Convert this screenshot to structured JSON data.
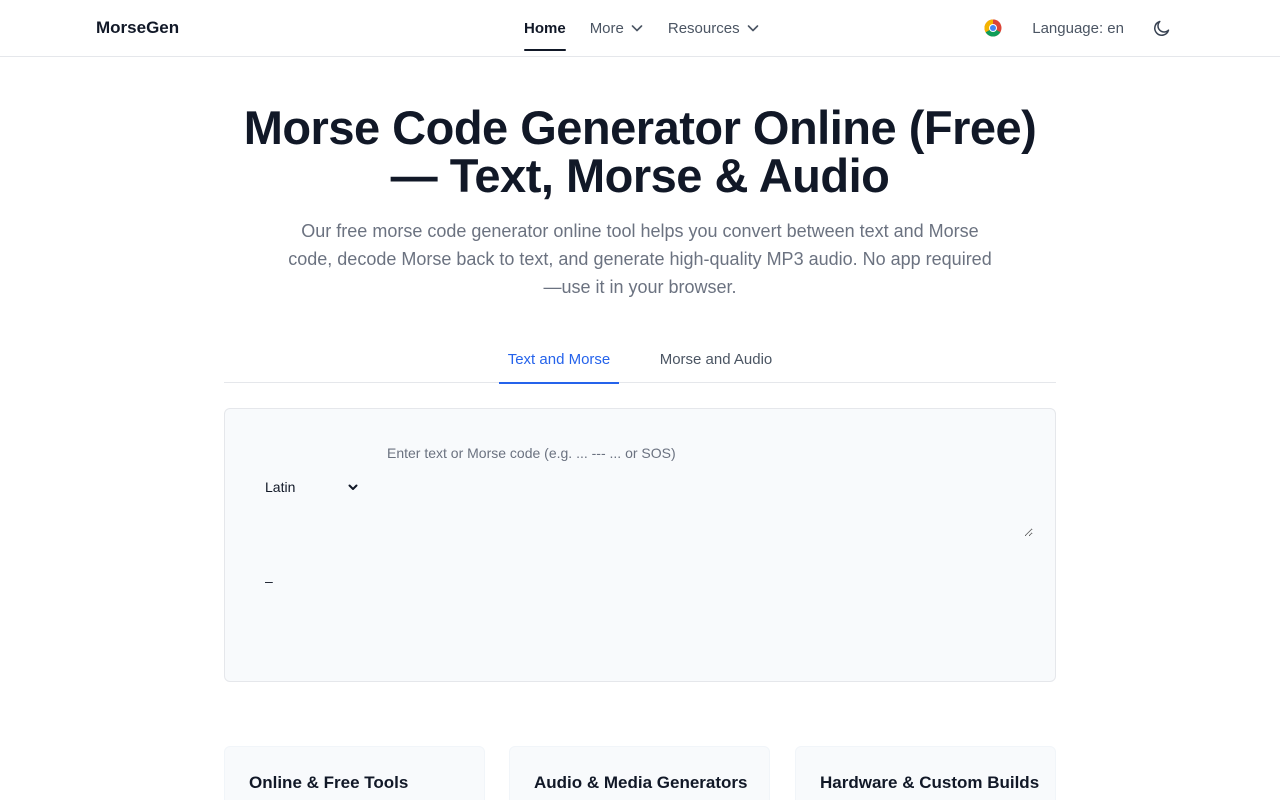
{
  "nav": {
    "brand": "MorseGen",
    "links": [
      {
        "label": "Home"
      },
      {
        "label": "More"
      },
      {
        "label": "Resources"
      }
    ],
    "language": "Language: en",
    "icons": {
      "browser": "chrome-icon",
      "theme": "moon-icon",
      "dropdown": "chevron-down-icon"
    }
  },
  "hero": {
    "title_line1": "Morse Code Generator Online (Free)",
    "title_line2": "— Text, Morse & Audio",
    "subtitle": "Our free morse code generator online tool helps you convert between text and Morse code, decode Morse back to text, and generate high-quality MP3 audio. No app required—use it in your browser."
  },
  "tabs": [
    {
      "label": "Text and Morse",
      "active": true
    },
    {
      "label": "Morse and Audio",
      "active": false
    }
  ],
  "converter": {
    "script_options": [
      "Latin"
    ],
    "script_selected": "Latin",
    "input_value": "",
    "input_placeholder": "Enter text or Morse code (e.g. ... --- ... or SOS)",
    "output": "–"
  },
  "cards": [
    {
      "title": "Online & Free Tools"
    },
    {
      "title": "Audio & Media Generators"
    },
    {
      "title": "Hardware & Custom Builds"
    }
  ],
  "colors": {
    "accent": "#2563eb",
    "text": "#111827",
    "muted": "#6b7280",
    "panel_bg": "#f8fafc",
    "border": "#e5e7eb"
  }
}
